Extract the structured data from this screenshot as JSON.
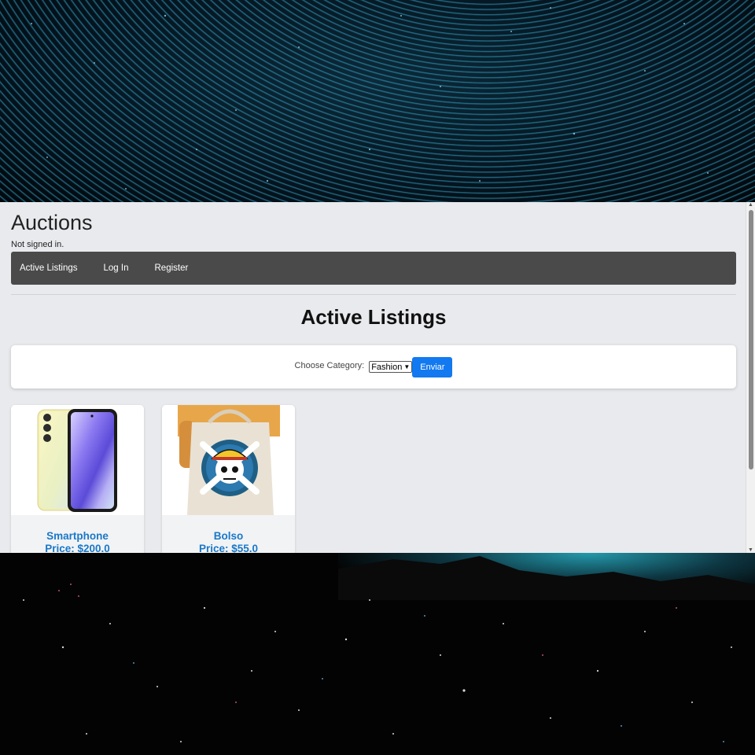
{
  "page": {
    "site_title": "Auctions",
    "signin_status": "Not signed in.",
    "nav": [
      "Active Listings",
      "Log In",
      "Register"
    ],
    "heading": "Active Listings"
  },
  "filter": {
    "label": "Choose Category:",
    "selected_category": "Fashion",
    "submit_label": "Enviar"
  },
  "listings": [
    {
      "title": "Smartphone",
      "price": "Price: $200.0",
      "image_icon": "smartphone-image"
    },
    {
      "title": "Bolso",
      "price": "Price: $55.0",
      "image_icon": "tote-bag-image"
    }
  ],
  "colors": {
    "navbar": "#4a4a4a",
    "accent_button": "#1279f0",
    "listing_text": "#1a78c8",
    "page_background": "#e8eaed"
  }
}
